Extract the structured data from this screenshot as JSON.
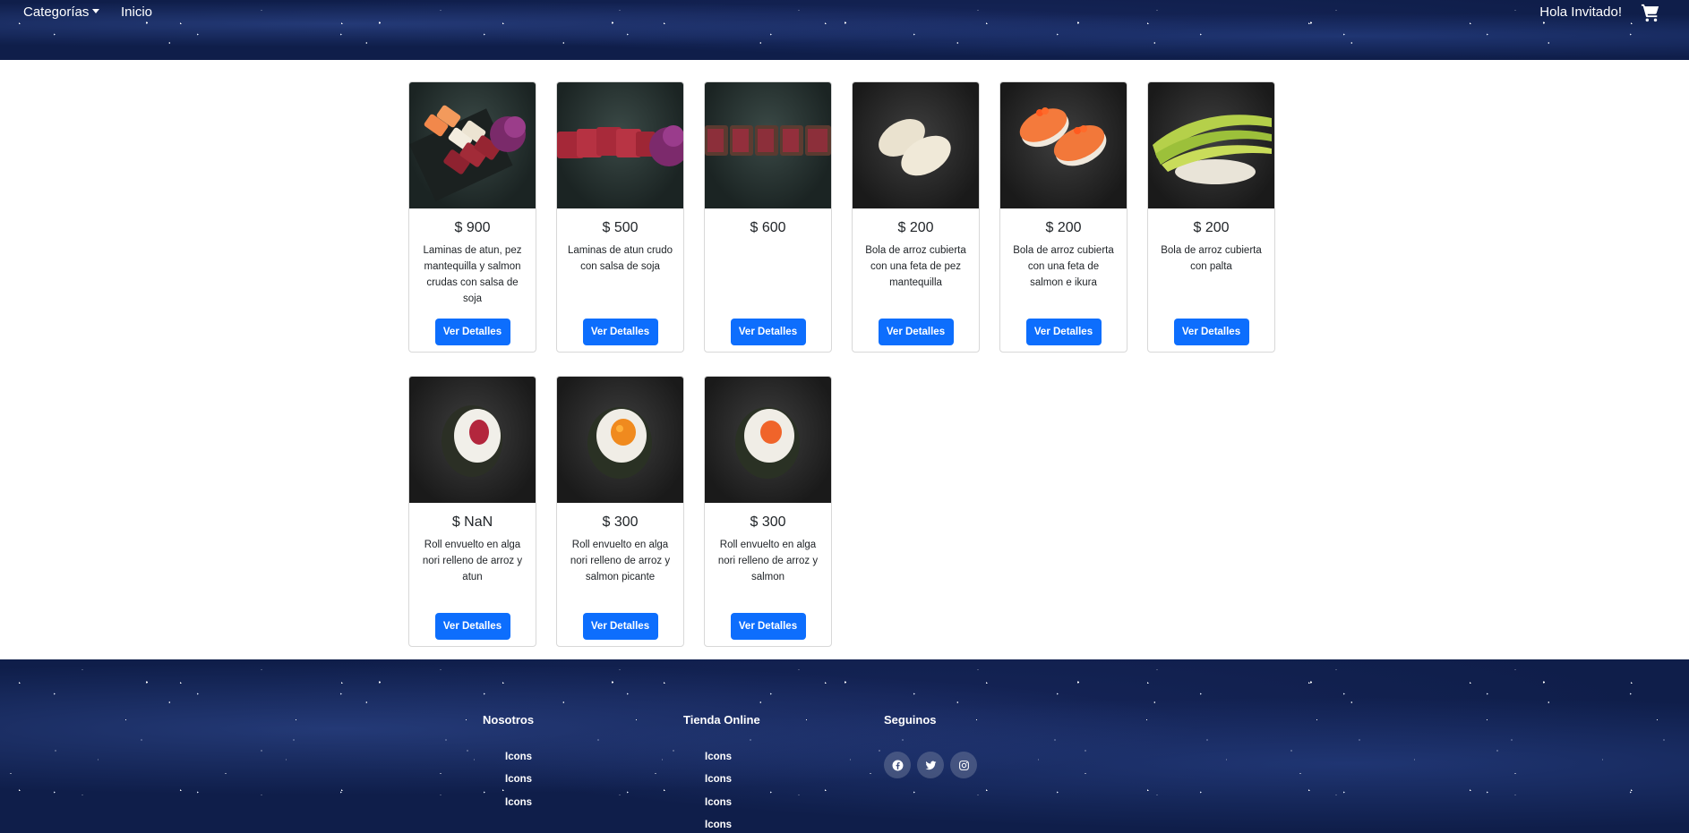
{
  "header": {
    "categories_label": "Categorías",
    "home_label": "Inicio",
    "greeting": "Hola Invitado!",
    "cart_icon": "cart-icon"
  },
  "products": [
    {
      "price": "$ 900",
      "description": "Laminas de atun, pez mantequilla y salmon crudas con salsa de soja",
      "button": "Ver Detalles",
      "image": "sashimi-mix"
    },
    {
      "price": "$ 500",
      "description": "Laminas de atun crudo con salsa de soja",
      "button": "Ver Detalles",
      "image": "sashimi-tuna"
    },
    {
      "price": "$ 600",
      "description": "",
      "button": "Ver Detalles",
      "image": "tataki"
    },
    {
      "price": "$ 200",
      "description": "Bola de arroz cubierta con una feta de pez mantequilla",
      "button": "Ver Detalles",
      "image": "nigiri-butterfish"
    },
    {
      "price": "$ 200",
      "description": "Bola de arroz cubierta con una feta de salmon e ikura",
      "button": "Ver Detalles",
      "image": "nigiri-salmon"
    },
    {
      "price": "$ 200",
      "description": "Bola de arroz cubierta con palta",
      "button": "Ver Detalles",
      "image": "nigiri-avocado"
    },
    {
      "price": "$ NaN",
      "description": "Roll envuelto en alga nori relleno de arroz y atun",
      "button": "Ver Detalles",
      "image": "roll-tuna"
    },
    {
      "price": "$ 300",
      "description": "Roll envuelto en alga nori relleno de arroz y salmon picante",
      "button": "Ver Detalles",
      "image": "roll-spicy-salmon"
    },
    {
      "price": "$ 300",
      "description": "Roll envuelto en alga nori relleno de arroz y salmon",
      "button": "Ver Detalles",
      "image": "roll-salmon"
    }
  ],
  "footer": {
    "columns": [
      {
        "title": "Nosotros",
        "links": [
          "Icons",
          "Icons",
          "Icons"
        ]
      },
      {
        "title": "Tienda Online",
        "links": [
          "Icons",
          "Icons",
          "Icons",
          "Icons"
        ]
      },
      {
        "title": "Seguinos",
        "icons": [
          "facebook-icon",
          "twitter-icon",
          "instagram-icon"
        ]
      }
    ]
  },
  "colors": {
    "accent": "#0d6efd",
    "header_bg": "#0f1e4a"
  }
}
